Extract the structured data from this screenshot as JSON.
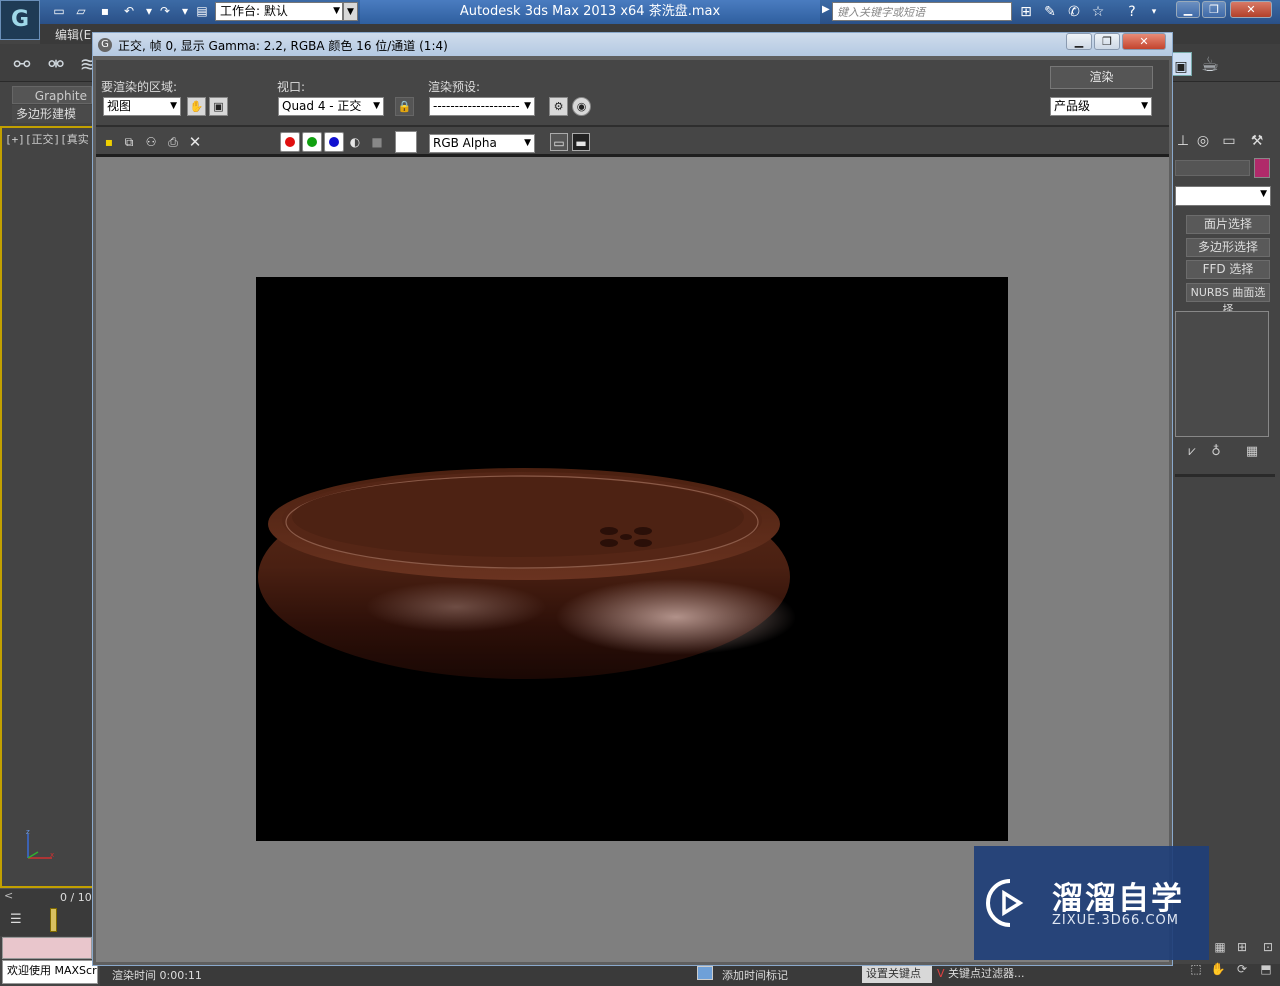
{
  "app": {
    "title": "Autodesk 3ds Max  2013 x64      茶洗盘.max",
    "logo_glyph": "G",
    "workspace_label": "工作台: 默认",
    "search_placeholder": "键入关键字或短语",
    "menu_edit": "编辑(E",
    "ribbon_tab": "Graphite",
    "ribbon_sub": "多边形建模",
    "viewport_label": "[+][正交][真实",
    "timeline_label": "0 / 10",
    "welcome": "欢迎使用 MAXScr",
    "render_time": "渲染时间  0:00:11",
    "add_tag": "添加时间标记",
    "set_key": "设置关键点",
    "key_filter": "关键点过滤器..."
  },
  "render_window": {
    "title": "正交, 帧 0, 显示 Gamma: 2.2, RGBA 颜色 16 位/通道 (1:4)",
    "area_label": "要渲染的区域:",
    "area_value": "视图",
    "viewport_label": "视口:",
    "viewport_value": "Quad 4 - 正交",
    "preset_label": "渲染预设:",
    "preset_value": "--------------------",
    "render_button": "渲染",
    "quality_value": "产品级",
    "channel_value": "RGB Alpha"
  },
  "command_panel": {
    "buttons": [
      "面片选择",
      "多边形选择",
      "FFD 选择",
      "NURBS 曲面选择"
    ]
  },
  "watermark": {
    "title": "溜溜自学",
    "url": "ZIXUE.3D66.COM"
  },
  "colors": {
    "object_color": "#b02a6a",
    "title_blue": "#2a5087",
    "channel_red": "#e01010",
    "channel_green": "#10a010",
    "channel_blue": "#1010d0"
  }
}
